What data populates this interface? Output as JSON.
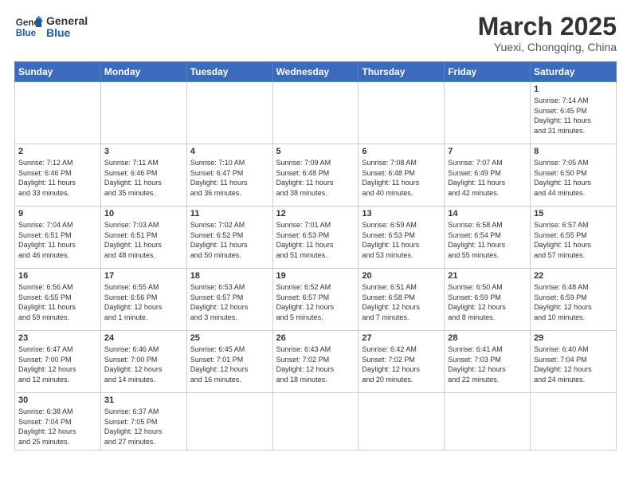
{
  "header": {
    "logo_general": "General",
    "logo_blue": "Blue",
    "month": "March 2025",
    "location": "Yuexi, Chongqing, China"
  },
  "weekdays": [
    "Sunday",
    "Monday",
    "Tuesday",
    "Wednesday",
    "Thursday",
    "Friday",
    "Saturday"
  ],
  "weeks": [
    [
      {
        "day": "",
        "info": ""
      },
      {
        "day": "",
        "info": ""
      },
      {
        "day": "",
        "info": ""
      },
      {
        "day": "",
        "info": ""
      },
      {
        "day": "",
        "info": ""
      },
      {
        "day": "",
        "info": ""
      },
      {
        "day": "1",
        "info": "Sunrise: 7:14 AM\nSunset: 6:45 PM\nDaylight: 11 hours\nand 31 minutes."
      }
    ],
    [
      {
        "day": "2",
        "info": "Sunrise: 7:12 AM\nSunset: 6:46 PM\nDaylight: 11 hours\nand 33 minutes."
      },
      {
        "day": "3",
        "info": "Sunrise: 7:11 AM\nSunset: 6:46 PM\nDaylight: 11 hours\nand 35 minutes."
      },
      {
        "day": "4",
        "info": "Sunrise: 7:10 AM\nSunset: 6:47 PM\nDaylight: 11 hours\nand 36 minutes."
      },
      {
        "day": "5",
        "info": "Sunrise: 7:09 AM\nSunset: 6:48 PM\nDaylight: 11 hours\nand 38 minutes."
      },
      {
        "day": "6",
        "info": "Sunrise: 7:08 AM\nSunset: 6:48 PM\nDaylight: 11 hours\nand 40 minutes."
      },
      {
        "day": "7",
        "info": "Sunrise: 7:07 AM\nSunset: 6:49 PM\nDaylight: 11 hours\nand 42 minutes."
      },
      {
        "day": "8",
        "info": "Sunrise: 7:05 AM\nSunset: 6:50 PM\nDaylight: 11 hours\nand 44 minutes."
      }
    ],
    [
      {
        "day": "9",
        "info": "Sunrise: 7:04 AM\nSunset: 6:51 PM\nDaylight: 11 hours\nand 46 minutes."
      },
      {
        "day": "10",
        "info": "Sunrise: 7:03 AM\nSunset: 6:51 PM\nDaylight: 11 hours\nand 48 minutes."
      },
      {
        "day": "11",
        "info": "Sunrise: 7:02 AM\nSunset: 6:52 PM\nDaylight: 11 hours\nand 50 minutes."
      },
      {
        "day": "12",
        "info": "Sunrise: 7:01 AM\nSunset: 6:53 PM\nDaylight: 11 hours\nand 51 minutes."
      },
      {
        "day": "13",
        "info": "Sunrise: 6:59 AM\nSunset: 6:53 PM\nDaylight: 11 hours\nand 53 minutes."
      },
      {
        "day": "14",
        "info": "Sunrise: 6:58 AM\nSunset: 6:54 PM\nDaylight: 11 hours\nand 55 minutes."
      },
      {
        "day": "15",
        "info": "Sunrise: 6:57 AM\nSunset: 6:55 PM\nDaylight: 11 hours\nand 57 minutes."
      }
    ],
    [
      {
        "day": "16",
        "info": "Sunrise: 6:56 AM\nSunset: 6:55 PM\nDaylight: 11 hours\nand 59 minutes."
      },
      {
        "day": "17",
        "info": "Sunrise: 6:55 AM\nSunset: 6:56 PM\nDaylight: 12 hours\nand 1 minute."
      },
      {
        "day": "18",
        "info": "Sunrise: 6:53 AM\nSunset: 6:57 PM\nDaylight: 12 hours\nand 3 minutes."
      },
      {
        "day": "19",
        "info": "Sunrise: 6:52 AM\nSunset: 6:57 PM\nDaylight: 12 hours\nand 5 minutes."
      },
      {
        "day": "20",
        "info": "Sunrise: 6:51 AM\nSunset: 6:58 PM\nDaylight: 12 hours\nand 7 minutes."
      },
      {
        "day": "21",
        "info": "Sunrise: 6:50 AM\nSunset: 6:59 PM\nDaylight: 12 hours\nand 8 minutes."
      },
      {
        "day": "22",
        "info": "Sunrise: 6:48 AM\nSunset: 6:59 PM\nDaylight: 12 hours\nand 10 minutes."
      }
    ],
    [
      {
        "day": "23",
        "info": "Sunrise: 6:47 AM\nSunset: 7:00 PM\nDaylight: 12 hours\nand 12 minutes."
      },
      {
        "day": "24",
        "info": "Sunrise: 6:46 AM\nSunset: 7:00 PM\nDaylight: 12 hours\nand 14 minutes."
      },
      {
        "day": "25",
        "info": "Sunrise: 6:45 AM\nSunset: 7:01 PM\nDaylight: 12 hours\nand 16 minutes."
      },
      {
        "day": "26",
        "info": "Sunrise: 6:43 AM\nSunset: 7:02 PM\nDaylight: 12 hours\nand 18 minutes."
      },
      {
        "day": "27",
        "info": "Sunrise: 6:42 AM\nSunset: 7:02 PM\nDaylight: 12 hours\nand 20 minutes."
      },
      {
        "day": "28",
        "info": "Sunrise: 6:41 AM\nSunset: 7:03 PM\nDaylight: 12 hours\nand 22 minutes."
      },
      {
        "day": "29",
        "info": "Sunrise: 6:40 AM\nSunset: 7:04 PM\nDaylight: 12 hours\nand 24 minutes."
      }
    ],
    [
      {
        "day": "30",
        "info": "Sunrise: 6:38 AM\nSunset: 7:04 PM\nDaylight: 12 hours\nand 25 minutes."
      },
      {
        "day": "31",
        "info": "Sunrise: 6:37 AM\nSunset: 7:05 PM\nDaylight: 12 hours\nand 27 minutes."
      },
      {
        "day": "",
        "info": ""
      },
      {
        "day": "",
        "info": ""
      },
      {
        "day": "",
        "info": ""
      },
      {
        "day": "",
        "info": ""
      },
      {
        "day": "",
        "info": ""
      }
    ]
  ]
}
